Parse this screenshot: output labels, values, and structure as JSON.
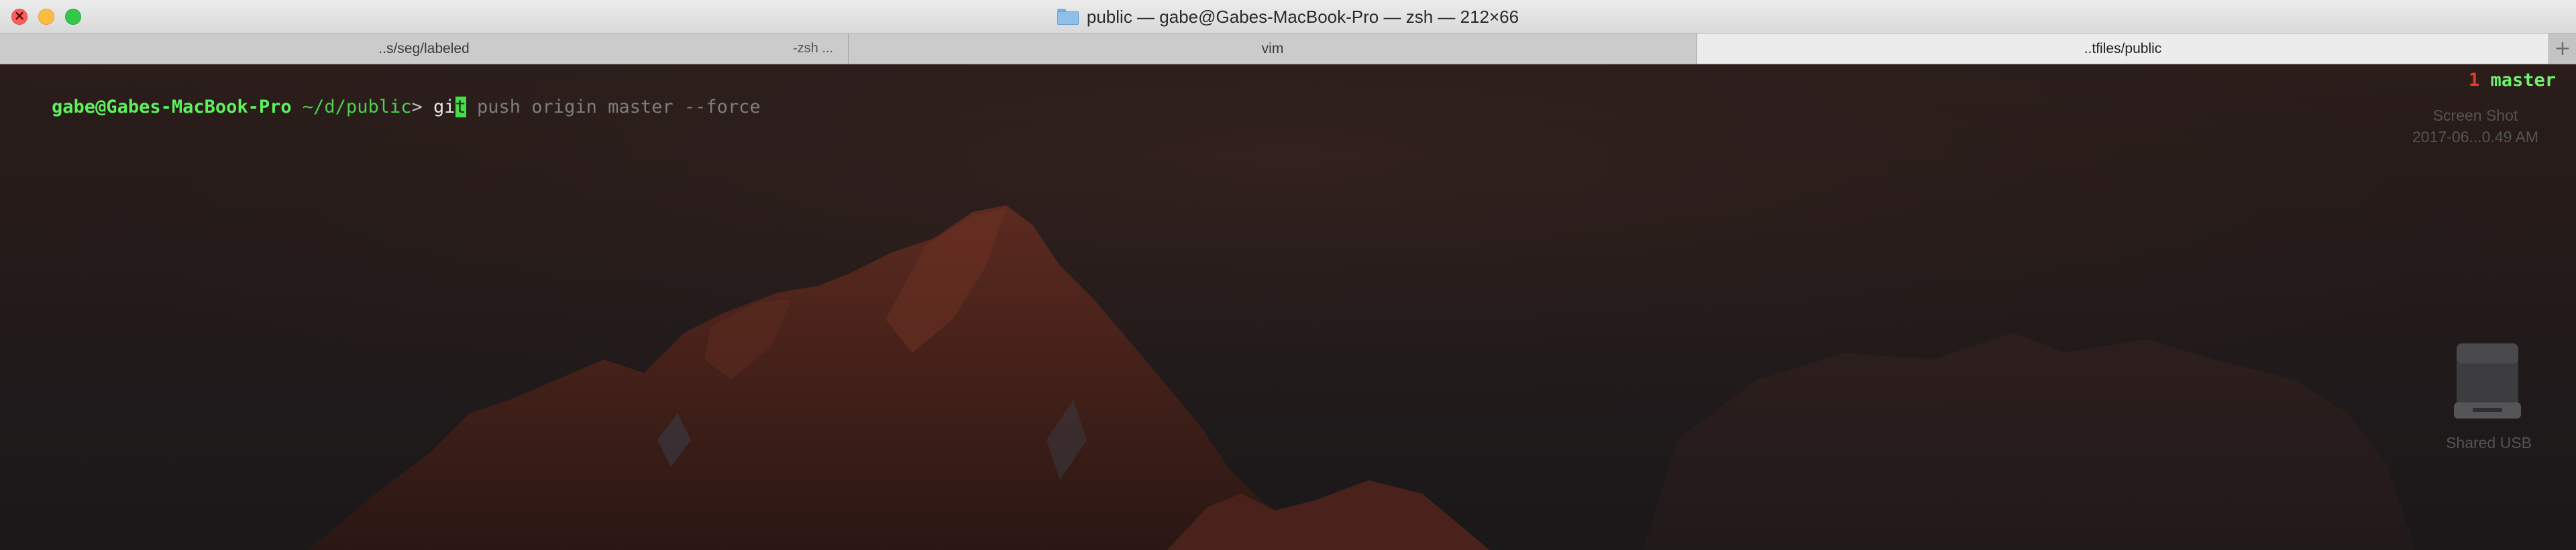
{
  "window": {
    "title": "public — gabe@Gabes-MacBook-Pro — zsh — 212×66",
    "folder_icon": "folder-icon"
  },
  "tabs": [
    {
      "label": "..s/seg/labeled",
      "sublabel": "-zsh ...",
      "active": false
    },
    {
      "label": "vim",
      "active": false
    },
    {
      "label": "..tfiles/public",
      "active": true
    }
  ],
  "new_tab_label": "+",
  "terminal": {
    "prompt_user": "gabe@Gabes-MacBook-Pro",
    "prompt_path": " ~/d/public",
    "prompt_symbol": "> ",
    "typed": "gi",
    "cursor_char": "t",
    "suggestion": " push origin master --force",
    "right_count": "1",
    "right_branch": " master"
  },
  "desktop": {
    "screenshot_label_1": "Screen Shot",
    "screenshot_label_2": "2017-06...0.49 AM",
    "usb_label": "Shared USB"
  },
  "colors": {
    "prompt_green": "#5ef25e",
    "cursor_green": "#43e043",
    "count_red": "#e33a2b",
    "suggestion_gray": "#7e7e7e"
  }
}
